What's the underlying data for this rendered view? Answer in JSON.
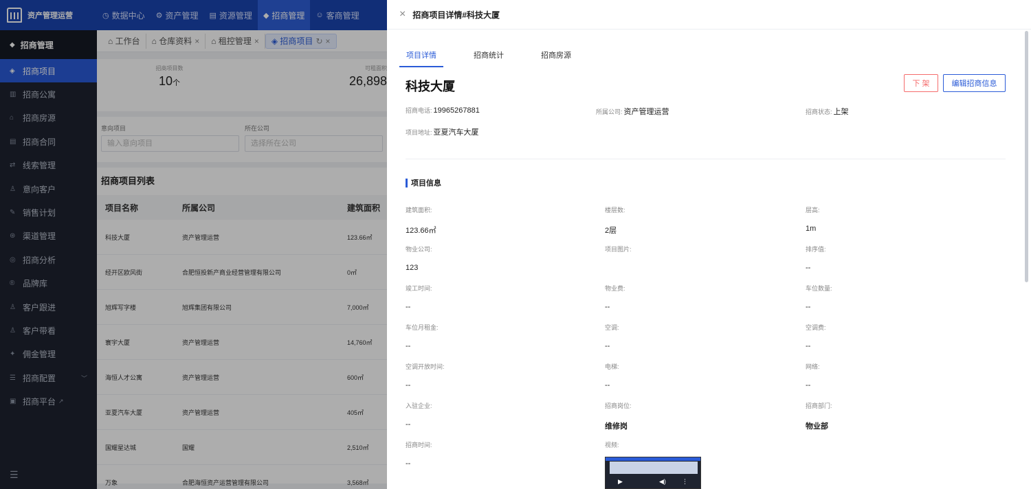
{
  "app": {
    "name": "资产管理运营"
  },
  "topnav": [
    {
      "icon": "◷",
      "label": "数据中心"
    },
    {
      "icon": "⚙",
      "label": "资产管理"
    },
    {
      "icon": "▤",
      "label": "资源管理"
    },
    {
      "icon": "◆",
      "label": "招商管理"
    },
    {
      "icon": "☺",
      "label": "客商管理"
    }
  ],
  "sidebar": {
    "header": "招商管理",
    "items": [
      {
        "icon": "◈",
        "label": "招商项目"
      },
      {
        "icon": "▥",
        "label": "招商公寓"
      },
      {
        "icon": "⌂",
        "label": "招商房源"
      },
      {
        "icon": "▤",
        "label": "招商合同"
      },
      {
        "icon": "⇄",
        "label": "线索管理"
      },
      {
        "icon": "♙",
        "label": "意向客户"
      },
      {
        "icon": "✎",
        "label": "销售计划"
      },
      {
        "icon": "⊛",
        "label": "渠道管理"
      },
      {
        "icon": "◎",
        "label": "招商分析"
      },
      {
        "icon": "®",
        "label": "品牌库"
      },
      {
        "icon": "♙",
        "label": "客户跟进"
      },
      {
        "icon": "♙",
        "label": "客户带看"
      },
      {
        "icon": "✦",
        "label": "佣金管理"
      },
      {
        "icon": "☰",
        "label": "招商配置"
      },
      {
        "icon": "▣",
        "label": "招商平台"
      }
    ],
    "footer_icon": "☰"
  },
  "tabs": [
    {
      "label": "工作台"
    },
    {
      "label": "仓库资料"
    },
    {
      "label": "租控管理"
    },
    {
      "label": "招商项目"
    }
  ],
  "stats": [
    {
      "label": "招商项目数",
      "value": "10",
      "unit": "个"
    },
    {
      "label": "可租面积",
      "value": "26,898"
    }
  ],
  "filters": [
    {
      "label": "意向项目",
      "placeholder": "输入意向项目"
    },
    {
      "label": "所在公司",
      "placeholder": "选择所在公司"
    }
  ],
  "list": {
    "title": "招商项目列表",
    "headers": [
      "项目名称",
      "所属公司",
      "建筑面积"
    ],
    "rows": [
      [
        "科技大厦",
        "资产管理运营",
        "123.66㎡"
      ],
      [
        "经开区欧风街",
        "合肥恒投新产商业经营管理有限公司",
        "0㎡"
      ],
      [
        "旭辉写字楼",
        "旭辉集团有限公司",
        "7,000㎡"
      ],
      [
        "寰宇大厦",
        "资产管理运营",
        "14,760㎡"
      ],
      [
        "海恒人才公寓",
        "资产管理运营",
        "600㎡"
      ],
      [
        "亚夏汽车大厦",
        "资产管理运营",
        "405㎡"
      ],
      [
        "国耀星达城",
        "国耀",
        "2,510㎡"
      ],
      [
        "万象",
        "合肥海恒资产运营管理有限公司",
        "3,568㎡"
      ]
    ]
  },
  "drawer": {
    "title": "招商项目详情#科技大厦",
    "tabs": [
      "项目详情",
      "招商统计",
      "招商房源"
    ],
    "project_name": "科技大厦",
    "btn_off": "下 架",
    "btn_edit": "编辑招商信息",
    "phone_label": "招商电话:",
    "phone": "19965267881",
    "company_label": "所属公司:",
    "company": "资产管理运营",
    "status_label": "招商状态:",
    "status": "上架",
    "address_label": "项目地址:",
    "address": "亚夏汽车大厦",
    "section_title": "项目信息",
    "fields": [
      {
        "label": "建筑面积:",
        "value": "123.66㎡"
      },
      {
        "label": "楼层数:",
        "value": "2层"
      },
      {
        "label": "层高:",
        "value": "1m"
      },
      {
        "label": "物业公司:",
        "value": "123"
      },
      {
        "label": "项目图片:",
        "value": ""
      },
      {
        "label": "排序值:",
        "value": "--"
      },
      {
        "label": "竣工时间:",
        "value": "--"
      },
      {
        "label": "物业费:",
        "value": "--"
      },
      {
        "label": "车位数量:",
        "value": "--"
      },
      {
        "label": "车位月租金:",
        "value": "--"
      },
      {
        "label": "空调:",
        "value": "--"
      },
      {
        "label": "空调费:",
        "value": "--"
      },
      {
        "label": "空调开放时间:",
        "value": "--"
      },
      {
        "label": "电梯:",
        "value": "--"
      },
      {
        "label": "网络:",
        "value": "--"
      },
      {
        "label": "入驻企业:",
        "value": "--"
      },
      {
        "label": "招商岗位:",
        "value": "维修岗"
      },
      {
        "label": "招商部门:",
        "value": "物业部"
      },
      {
        "label": "招商时间:",
        "value": "--"
      },
      {
        "label": "视频:",
        "value": ""
      }
    ]
  }
}
